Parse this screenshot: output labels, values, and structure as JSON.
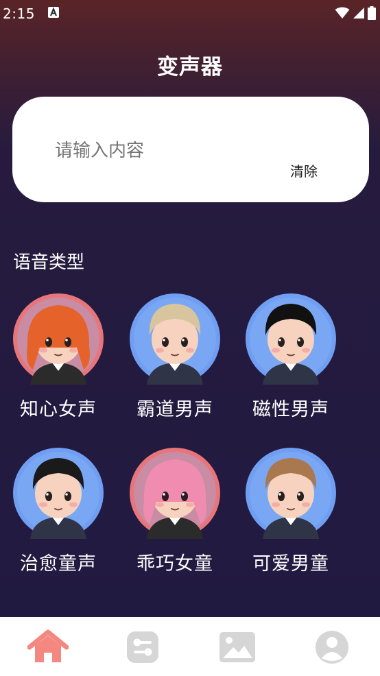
{
  "status_bar": {
    "time": "2:15",
    "notification_icon": "a-app-icon",
    "icons": [
      "wifi-icon",
      "signal-icon",
      "battery-icon"
    ]
  },
  "header": {
    "title": "变声器"
  },
  "input": {
    "placeholder": "请输入内容",
    "clear_label": "清除"
  },
  "section": {
    "title": "语音类型"
  },
  "voices": [
    {
      "label": "知心女声",
      "avatar": "girl-orange-hair",
      "ring": "#e8757a",
      "hair": "#e5632a",
      "skin": "#f7d3bf"
    },
    {
      "label": "霸道男声",
      "avatar": "boy-curly-blonde",
      "ring": "#6f9ef2",
      "hair": "#d8c59e",
      "skin": "#f7d3bf"
    },
    {
      "label": "磁性男声",
      "avatar": "boy-black-hair",
      "ring": "#6f9ef2",
      "hair": "#111111",
      "skin": "#f7d3bf"
    },
    {
      "label": "治愈童声",
      "avatar": "boy-black-hair-tie",
      "ring": "#6f9ef2",
      "hair": "#1a1a1a",
      "skin": "#f7d3bf"
    },
    {
      "label": "乖巧女童",
      "avatar": "girl-pink-hair",
      "ring": "#e8757a",
      "hair": "#f08cb0",
      "skin": "#f7d3bf"
    },
    {
      "label": "可爱男童",
      "avatar": "boy-brown-hair-vest",
      "ring": "#6f9ef2",
      "hair": "#a9784f",
      "skin": "#f7d3bf"
    }
  ],
  "nav": {
    "items": [
      {
        "icon": "home-icon",
        "active": true
      },
      {
        "icon": "convert-icon",
        "active": false
      },
      {
        "icon": "image-icon",
        "active": false
      },
      {
        "icon": "profile-icon",
        "active": false
      }
    ],
    "active_color": "#f4877f",
    "inactive_color": "#d6d6d6"
  }
}
